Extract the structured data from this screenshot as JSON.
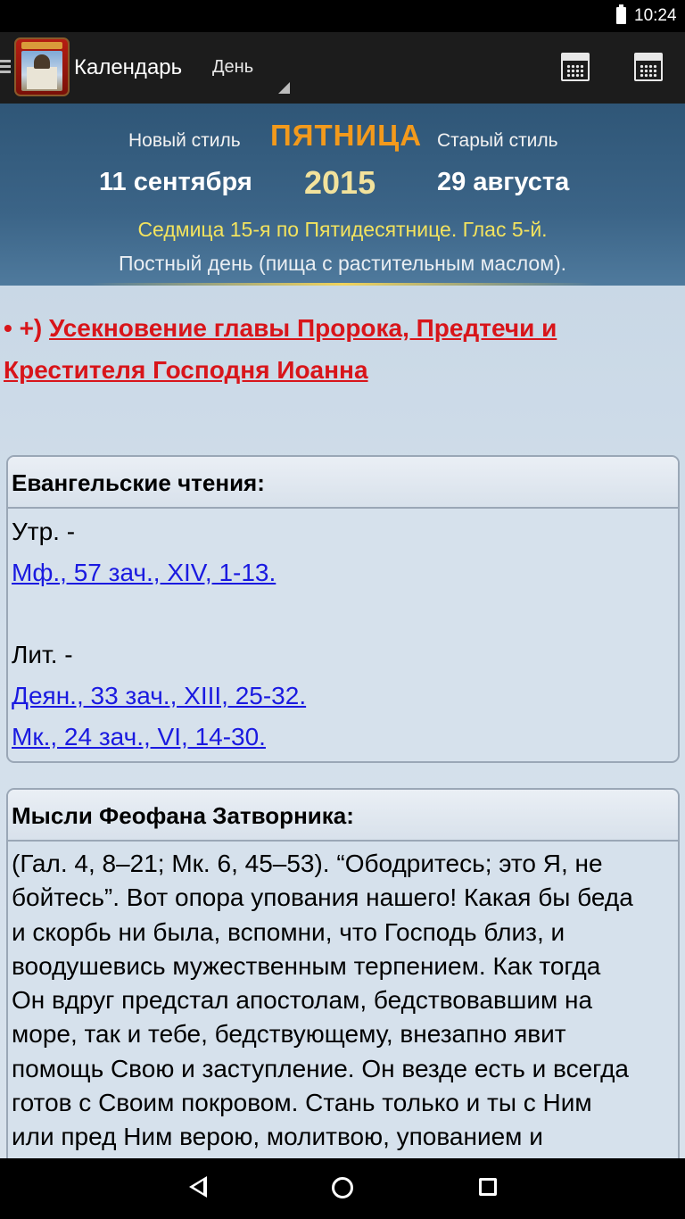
{
  "status_bar": {
    "time": "10:24"
  },
  "action_bar": {
    "title": "Календарь",
    "view_mode": "День",
    "icons": [
      "drawer-icon",
      "calendar-week-icon",
      "calendar-month-icon"
    ]
  },
  "date_header": {
    "new_style_label": "Новый стиль",
    "day_name": "ПЯТНИЦА",
    "old_style_label": "Старый стиль",
    "new_style_date": "11 сентября",
    "year": "2015",
    "old_style_date": "29 августа",
    "week_info": "Седмица 15-я по Пятидесятнице. Глас 5-й.",
    "fast_info": "Постный день (пища с растительным маслом)."
  },
  "feast": {
    "marker": "• +)",
    "title": "Усекновение главы Пророка, Предтечи и Крестителя Господня Иоанна"
  },
  "gospel_readings": {
    "heading": "Евангельские чтения:",
    "matins_label": "Утр. -",
    "matins_links": [
      "Мф., 57 зач., XIV, 1-13."
    ],
    "liturgy_label": "Лит. -",
    "liturgy_links": [
      "Деян., 33 зач., XIII, 25-32.",
      "Мк., 24 зач., VI, 14-30."
    ]
  },
  "theophan_thoughts": {
    "heading": "Мысли Феофана Затворника:",
    "lines": [
      "(Гал. 4, 8–21; Мк. 6, 45–53). “Ободритесь; это Я, не",
      "бойтесь”. Вот опора упования нашего! Какая бы беда",
      "и скорбь ни была, вспомни, что Господь близ, и",
      "воодушевись мужественным терпением. Как тогда",
      "Он вдруг предстал апостолам, бедствовавшим на",
      "море, так и тебе, бедствующему, внезапно явит",
      "помощь Свою и заступление. Он везде есть и всегда",
      "готов с Своим покровом. Стань только и ты с Ним",
      "или пред Ним верою, молитвою, упованием и"
    ]
  },
  "colors": {
    "feast_red": "#d8151a",
    "day_orange": "#f39a1c",
    "link_blue": "#1a1ae0",
    "week_yellow": "#f3e35e"
  }
}
